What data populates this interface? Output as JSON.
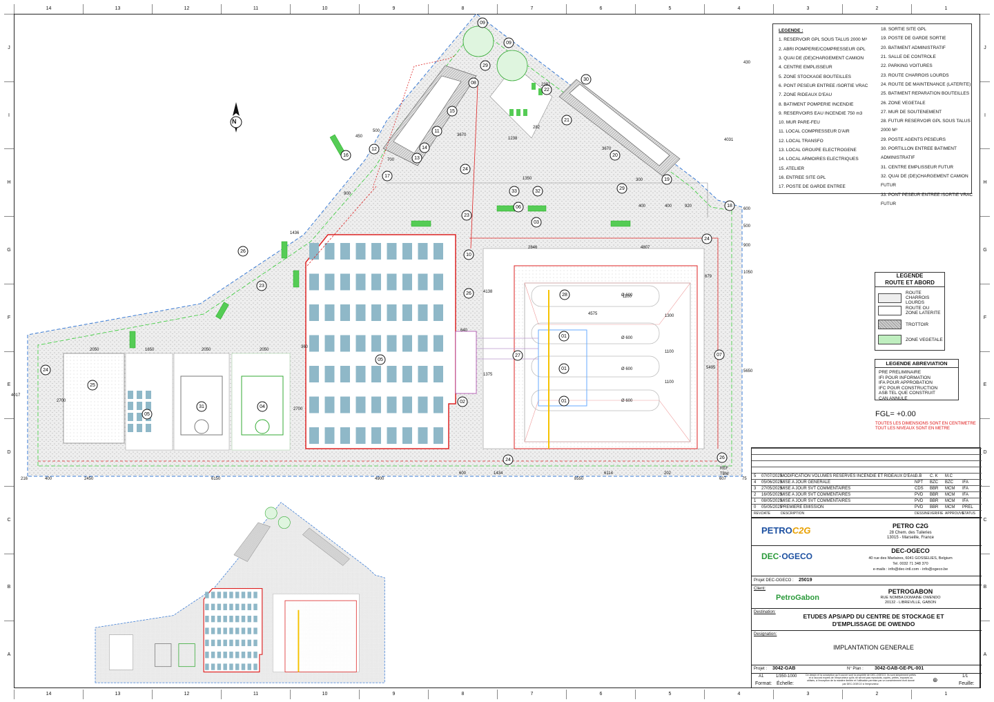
{
  "grid": {
    "columns": [
      "14",
      "13",
      "12",
      "11",
      "10",
      "9",
      "8",
      "7",
      "6",
      "5",
      "4",
      "3",
      "2",
      "1"
    ],
    "rows": [
      "J",
      "I",
      "H",
      "G",
      "F",
      "E",
      "D",
      "C",
      "B",
      "A"
    ]
  },
  "north": "N",
  "legend": {
    "title": "LEGENDE :",
    "items_left": [
      "1.    RESERVOIR GPL SOUS TALUS 2000 M³",
      "2.    ABRI POMPERIE/COMPRESSEUR GPL",
      "3.    QUAI DE (DE)CHARGEMENT CAMION",
      "4.    CENTRE EMPLISSEUR",
      "5.    ZONE STOCKAGE BOUTEILLES",
      "6.    PONT PESEUR ENTREE /SORTIE VRAC",
      "7.    ZONE RIDEAUX D'EAU",
      "8.    BATIMENT POMPERIE INCENDIE",
      "9.    RESERVOIRS EAU INCENDIE 750 m3",
      "10.  MUR PARE-FEU",
      "11.  LOCAL COMPRESSEUR D'AIR",
      "12.  LOCAL TRANSFO",
      "13.  LOCAL GROUPE ELECTROGENE",
      "14.  LOCAL ARMOIRES ELECTRIQUES",
      "15.  ATELIER",
      "16.  ENTREE SITE GPL",
      "17.  POSTE DE GARDE ENTREE"
    ],
    "items_right": [
      "18.  SORTIE SITE GPL",
      "19.  POSTE DE GARDE SORTIE",
      "20.  BATIMENT ADMINISTRATIF",
      "21.  SALLE DE CONTROLE",
      "22.  PARKING VOITURES",
      "23.  ROUTE CHARROIS LOURDS",
      "24.  ROUTE DE MAINTENANCE (LATERITE)",
      "25.  BATIMENT REPARATION BOUTEILLES",
      "26.  ZONE VEGETALE",
      "27.  MUR DE SOUTENEMENT",
      "28.  FUTUR RESERVOIR GPL SOUS TALUS",
      "       2000 M³",
      "29.  POSTE AGENTS PESEURS",
      "30.  PORTILLON ENTREE BATIMENT",
      "       ADMINISTRATIF",
      "31.  CENTRE EMPLISSEUR FUTUR",
      "32.  QUAI DE (DE)CHARGEMENT CAMION",
      "       FUTUR",
      "33.  PONT PESEUR ENTREE /SORTIE VRAC",
      "       FUTUR"
    ]
  },
  "legend_route": {
    "title1": "LEGENDE",
    "title2": "ROUTE ET ABORD",
    "items": [
      "ROUTE CHARROIS LOURDS",
      "ROUTE OU ZONE LATERITE",
      "TROTTOIR",
      "ZONE VEGETALE"
    ]
  },
  "legend_abbrev": {
    "title": "LEGENDE ABREVIATION",
    "items": [
      "PRE    PRELIMINAIRE",
      "IFI     POUR INFORMATION",
      "IFA     POUR APPROBATION",
      "IFC     POUR CONSTRUCTION",
      "ASB    TEL QUE CONSTRUIT",
      "CAN    ANNULE"
    ]
  },
  "fgl": "FGL= +0.00",
  "notes": [
    "TOUTES LES DIMENSIONS SONT EN CENTIMETRE",
    "TOUT LES NIVEAUX SONT EN METRE"
  ],
  "revisions": [
    {
      "rev": "5",
      "date": "07/07/2025",
      "desc": "MODIFICATION VOLUMES RESERVES INCENDIE ET RIDEAUX D'EAU",
      "des": "G.B",
      "ver": "C. K",
      "app": "M.C",
      "st": ""
    },
    {
      "rev": "4",
      "date": "05/06/2025",
      "desc": "MISE A JOUR GENERALE",
      "des": "NPT",
      "ver": "BZC",
      "app": "BZC",
      "st": "IFA"
    },
    {
      "rev": "3",
      "date": "27/05/2025",
      "desc": "MISE A JOUR SVT COMMENTAIRES",
      "des": "CDS",
      "ver": "BBR",
      "app": "MCM",
      "st": "IFA"
    },
    {
      "rev": "2",
      "date": "16/05/2025",
      "desc": "MISE A JOUR SVT COMMENTAIRES",
      "des": "PVD",
      "ver": "BBR",
      "app": "MCM",
      "st": "IFA"
    },
    {
      "rev": "1",
      "date": "08/05/2025",
      "desc": "MISE A JOUR SVT COMMENTAIRES",
      "des": "PVD",
      "ver": "BBR",
      "app": "MCM",
      "st": "IFA"
    },
    {
      "rev": "0",
      "date": "05/05/2025",
      "desc": "PREMIERE EMISSION",
      "des": "PVD",
      "ver": "BBR",
      "app": "MCM",
      "st": "PREL"
    }
  ],
  "rev_header": {
    "rev": "REV.",
    "date": "DATE",
    "desc": "DESCRIPTION",
    "des": "DESSINE",
    "ver": "VERIFIE",
    "app": "APPROUVE",
    "st": "STATUS"
  },
  "client1": {
    "logo1": "PETRO",
    "logo2": "C2G",
    "name": "PETRO C2G",
    "addr1": "28 Chem. des Tuileries",
    "addr2": "13015 - Marseille, France"
  },
  "client2": {
    "logo1": "DEC",
    "logo2": "OGECO",
    "name": "DEC-OGECO",
    "addr1": "40 rue des Marlaires, 6041 GOSSELIES, Belgium",
    "addr2": "Tel. 0032 71 348 370",
    "addr3": "e-mails : info@dec-intl.com - info@ogeco.be"
  },
  "project_ref": {
    "label": "Projet DEC-OGECO :",
    "value": "25019"
  },
  "client": {
    "label": "Client:",
    "logo": "PetroGabon",
    "name": "PETROGABON",
    "addr1": "RUE NOMBA DOMAINE OWENDO",
    "addr2": "20132 - LIBREVILLE, GABON"
  },
  "destination": {
    "label": "Destination:",
    "line1": "ETUDES APS/APD DU CENTRE DE STOCKAGE ET",
    "line2": "D'EMPLISSAGE DE OWENDO"
  },
  "designation": {
    "label": "Designation:",
    "value": "IMPLANTATION GENERALE"
  },
  "footer": {
    "projet_label": "Projet :",
    "projet": "3042-GAB",
    "plan_label": "N° Plan :",
    "plan": "3042-GAB-GE-PL-001",
    "format": "A1",
    "format_label": "Format:",
    "scale": "1/350-1000",
    "scale_label": "Échelle:",
    "sheet": "1/1",
    "sheet_label": "Feuille:",
    "disclaimer": "Ce dessin et la conception qu'il couvre sont la propriété de DEC-OGECO. Ils sont simplement prêtés et à l'accord exprès de l'emprunteur qu'ils ne seront pas reproduits, copiés, prêtés, exposés ou utilisés, à l'exception de la manière limitée et l'utilisation permise par un consentement écrit donné par DEC-OGECO à l'emprunteur."
  },
  "markers": [
    "01",
    "02",
    "03",
    "04",
    "05",
    "06",
    "07",
    "08",
    "09",
    "10",
    "11",
    "12",
    "13",
    "14",
    "15",
    "16",
    "17",
    "18",
    "19",
    "20",
    "21",
    "22",
    "23",
    "24",
    "25",
    "26",
    "27",
    "28",
    "29",
    "30",
    "31",
    "32",
    "33"
  ],
  "dimensions": [
    "2050",
    "1650",
    "2050",
    "2050",
    "2700",
    "2700",
    "4017",
    "5650",
    "5495",
    "4807",
    "2846",
    "4575",
    "4138",
    "1375",
    "640",
    "360",
    "1436",
    "1350",
    "900",
    "500",
    "450",
    "700",
    "3670",
    "1238",
    "3670",
    "282",
    "2397",
    "216",
    "400",
    "2450",
    "6150",
    "4900",
    "8550",
    "600",
    "1434",
    "6114",
    "202",
    "607",
    "75",
    "920",
    "400",
    "400",
    "300",
    "600",
    "500",
    "900",
    "1050",
    "430",
    "4031",
    "679",
    "1100",
    "1300",
    "1100",
    "1100",
    "Ø 600",
    "Ø 600",
    "Ø 600",
    "Ø 600",
    "REF",
    "TBM"
  ]
}
